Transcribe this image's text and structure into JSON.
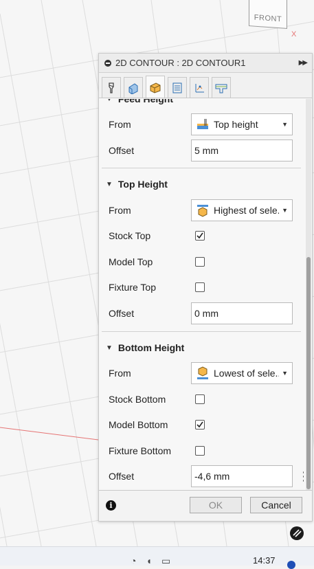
{
  "viewcube": {
    "face_label": "FRONT",
    "axis_label": "X"
  },
  "panel": {
    "title": "2D CONTOUR : 2D CONTOUR1",
    "tabs": [
      {
        "name": "tool"
      },
      {
        "name": "geometry"
      },
      {
        "name": "heights",
        "active": true
      },
      {
        "name": "passes"
      },
      {
        "name": "linking"
      },
      {
        "name": "post"
      }
    ],
    "feed_height": {
      "header_partial": "Feed Height",
      "from_label": "From",
      "from_value": "Top height",
      "offset_label": "Offset",
      "offset_value": "5 mm"
    },
    "top_height": {
      "header": "Top Height",
      "from_label": "From",
      "from_value": "Highest of sele...",
      "stock_top_label": "Stock Top",
      "stock_top_checked": true,
      "model_top_label": "Model Top",
      "model_top_checked": false,
      "fixture_top_label": "Fixture Top",
      "fixture_top_checked": false,
      "offset_label": "Offset",
      "offset_value": "0 mm"
    },
    "bottom_height": {
      "header": "Bottom Height",
      "from_label": "From",
      "from_value": "Lowest of sele...",
      "stock_bottom_label": "Stock Bottom",
      "stock_bottom_checked": false,
      "model_bottom_label": "Model Bottom",
      "model_bottom_checked": true,
      "fixture_bottom_label": "Fixture Bottom",
      "fixture_bottom_checked": false,
      "offset_label": "Offset",
      "offset_value": "-4,6 mm"
    },
    "buttons": {
      "ok": "OK",
      "cancel": "Cancel"
    }
  },
  "taskbar": {
    "time": "14:37"
  },
  "colors": {
    "accent": "#1f4fb6",
    "grid": "#dcdcdc",
    "axis_red": "#e57373"
  }
}
